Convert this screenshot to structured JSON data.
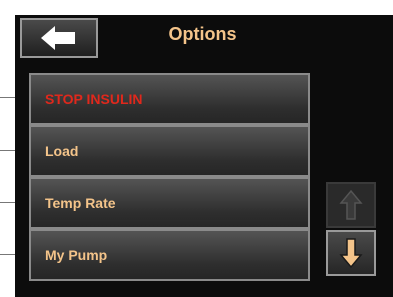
{
  "header": {
    "title": "Options",
    "back_icon": "arrow-left-icon"
  },
  "menu": {
    "items": [
      {
        "label": "STOP INSULIN",
        "color": "#e0281c"
      },
      {
        "label": "Load",
        "color": "#f4c48a"
      },
      {
        "label": "Temp Rate",
        "color": "#f4c48a"
      },
      {
        "label": "My Pump",
        "color": "#f4c48a"
      }
    ]
  },
  "scroll": {
    "up_icon": "arrow-up-icon",
    "down_icon": "arrow-down-icon",
    "up_enabled": false,
    "down_enabled": true
  },
  "colors": {
    "accent": "#f4c48a",
    "danger": "#e0281c",
    "background": "#0c0c0c"
  }
}
